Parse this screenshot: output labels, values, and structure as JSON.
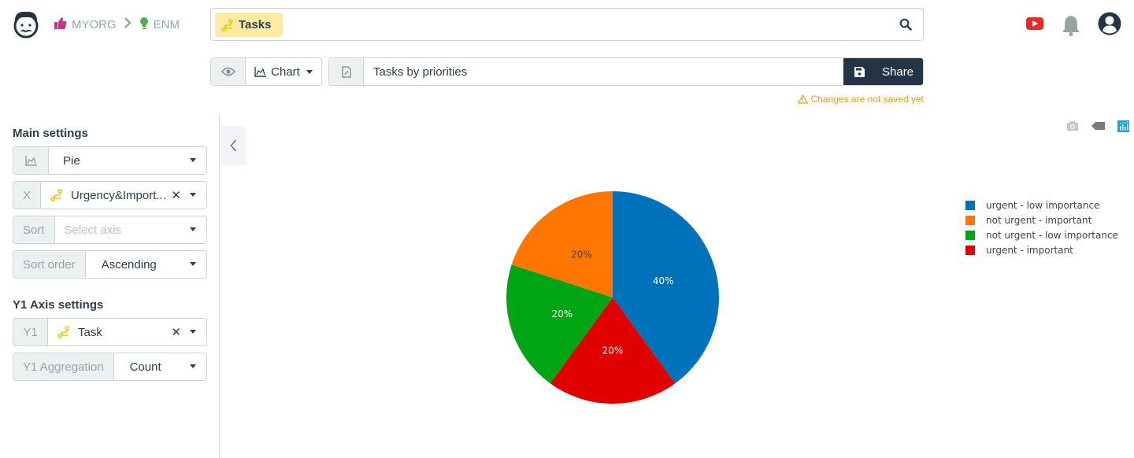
{
  "header": {
    "breadcrumb": [
      {
        "label": "MYORG",
        "icon": "thumbs-up-icon",
        "color": "#c0397f"
      },
      {
        "label": "ENM",
        "icon": "lightbulb-icon",
        "color": "#4caf50"
      }
    ],
    "search": {
      "tag_label": "Tasks",
      "tag_icon": "route-icon"
    },
    "icons": [
      "youtube-icon",
      "bell-icon",
      "user-icon"
    ]
  },
  "toolbar": {
    "view_icon": "eye-icon",
    "chart_button_label": "Chart",
    "title_value": "Tasks by priorities",
    "share_label": "Share",
    "warning": "Changes are not saved yet"
  },
  "sidebar": {
    "main_title": "Main settings",
    "chart_type": {
      "value": "Pie"
    },
    "x": {
      "label": "X",
      "value": "Urgency&Import..."
    },
    "sort": {
      "label": "Sort",
      "placeholder": "Select axis"
    },
    "sort_order": {
      "label": "Sort order",
      "value": "Ascending"
    },
    "y1_title": "Y1 Axis settings",
    "y1": {
      "label": "Y1",
      "value": "Task"
    },
    "y1_aggregation": {
      "label": "Y1 Aggregation",
      "value": "Count"
    }
  },
  "modebar": [
    "camera-icon",
    "tag-icon",
    "plotly-logo-icon"
  ],
  "chart_data": {
    "type": "pie",
    "title": "Tasks by priorities",
    "categories": [
      "urgent - low importance",
      "urgent - important",
      "not urgent - low importance",
      "not urgent - important"
    ],
    "values": [
      40,
      20,
      20,
      20
    ],
    "labels": [
      "40%",
      "20%",
      "20%",
      "20%"
    ],
    "colors": [
      "#0072bc",
      "#e00000",
      "#00a514",
      "#ff7700"
    ],
    "label_colors": [
      "#ffffff",
      "#ffffff",
      "#ffffff",
      "#444444"
    ],
    "legend": {
      "placement": "top-right",
      "entries": [
        {
          "label": "urgent - low importance",
          "color": "#0072bc"
        },
        {
          "label": "not urgent - important",
          "color": "#ff7700"
        },
        {
          "label": "not urgent - low importance",
          "color": "#00a514"
        },
        {
          "label": "urgent - important",
          "color": "#e00000"
        }
      ]
    }
  }
}
